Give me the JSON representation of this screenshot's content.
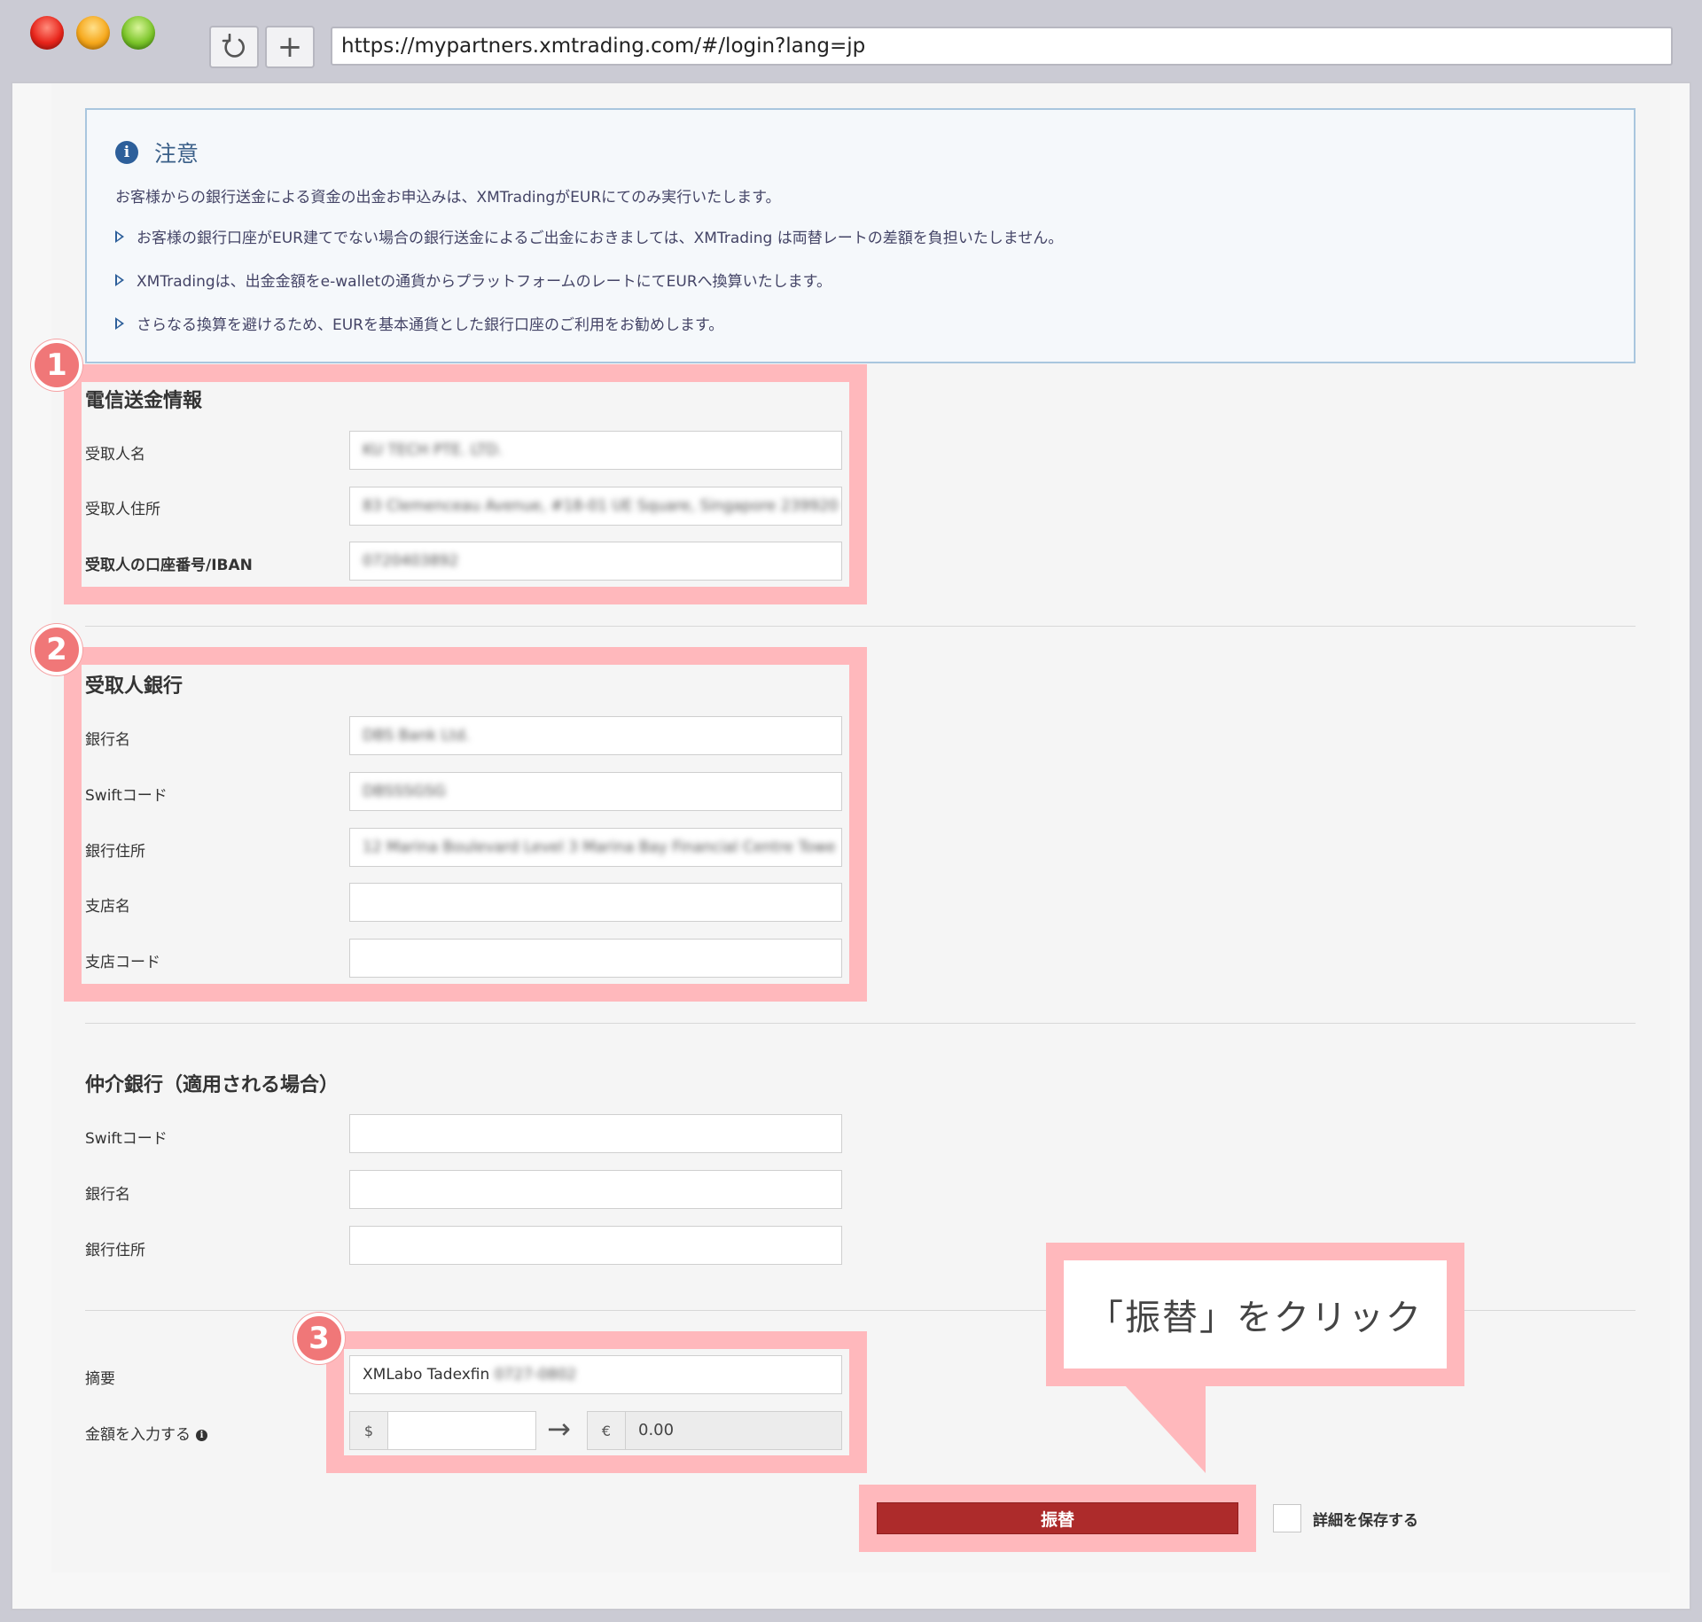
{
  "browser": {
    "url": "https://mypartners.xmtrading.com/#/login?lang=jp",
    "new_tab_label": "+"
  },
  "notice": {
    "title": "注意",
    "lead": "お客様からの銀行送金による資金の出金お申込みは、XMTradingがEURにてのみ実行いたします。",
    "items": [
      "お客様の銀行口座がEUR建てでない場合の銀行送金によるご出金におきましては、XMTrading は両替レートの差額を負担いたしません。",
      "XMTradingは、出金金額をe-walletの通貨からプラットフォームのレートにてEURへ換算いたします。",
      "さらなる換算を避けるため、EURを基本通貨とした銀行口座のご利用をお勧めします。"
    ]
  },
  "wire": {
    "badge": "1",
    "title": "電信送金情報",
    "fields": [
      {
        "label": "受取人名",
        "value": "KU TECH PTE. LTD."
      },
      {
        "label": "受取人住所",
        "value": "83 Clemenceau Avenue, #18-01 UE Square, Singapore 239920"
      },
      {
        "label": "受取人の口座番号/IBAN",
        "value": "0720403892"
      }
    ]
  },
  "bank": {
    "badge": "2",
    "title": "受取人銀行",
    "fields": [
      {
        "label": "銀行名",
        "value": "DBS Bank Ltd."
      },
      {
        "label": "Swiftコード",
        "value": "DBSSSGSG"
      },
      {
        "label": "銀行住所",
        "value": "12 Marina Boulevard Level 3 Marina Bay Financial Centre Towe"
      },
      {
        "label": "支店名",
        "value": ""
      },
      {
        "label": "支店コード",
        "value": ""
      }
    ]
  },
  "intermediary": {
    "title": "仲介銀行（適用される場合）",
    "fields": [
      {
        "label": "Swiftコード",
        "value": ""
      },
      {
        "label": "銀行名",
        "value": ""
      },
      {
        "label": "銀行住所",
        "value": ""
      }
    ]
  },
  "transfer": {
    "badge": "3",
    "memo_label": "摘要",
    "memo_value": "XMLabo Tadexfin",
    "memo_value_hidden": "0727-0802",
    "amount_label": "金額を入力する",
    "currency_from": "$",
    "currency_to": "€",
    "converted_amount": "0.00",
    "arrow": "→"
  },
  "callout": {
    "text": "「振替」をクリック"
  },
  "actions": {
    "submit_label": "振替",
    "save_details_label": "詳細を保存する"
  },
  "colors": {
    "highlight": "#ffb8bc",
    "badge": "#f07778",
    "submit": "#ad2b2b",
    "notice_border": "#a9c6de",
    "notice_icon": "#2d5f9a"
  }
}
